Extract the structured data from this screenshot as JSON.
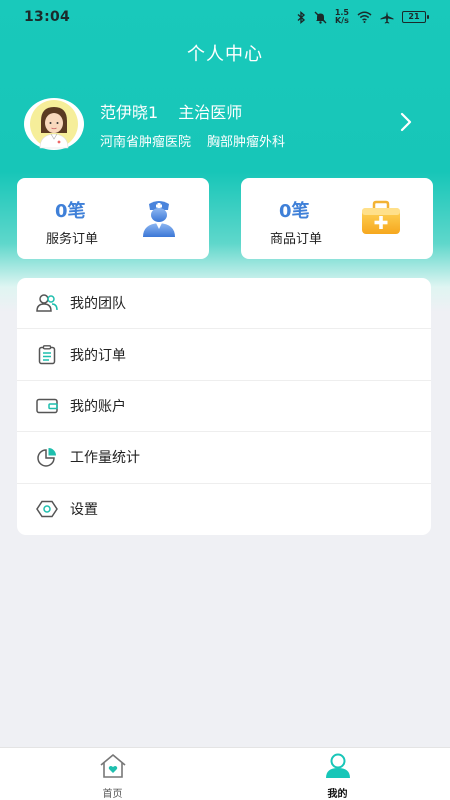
{
  "status_bar": {
    "time": "13:04",
    "net_speed_value": "1.5",
    "net_speed_unit": "K/s",
    "battery": "21",
    "icons": [
      "bluetooth-icon",
      "mute-icon",
      "wifi-icon",
      "airplane-icon",
      "battery-icon"
    ]
  },
  "header": {
    "title": "个人中心"
  },
  "profile": {
    "name": "范伊晓1",
    "job_title": "主治医师",
    "hospital": "河南省肿瘤医院",
    "department": "胸部肿瘤外科"
  },
  "stats": {
    "service_orders": {
      "count": "0笔",
      "label": "服务订单"
    },
    "product_orders": {
      "count": "0笔",
      "label": "商品订单"
    }
  },
  "menu": {
    "items": [
      {
        "label": "我的团队",
        "icon": "team-icon"
      },
      {
        "label": "我的订单",
        "icon": "order-list-icon"
      },
      {
        "label": "我的账户",
        "icon": "wallet-icon"
      },
      {
        "label": "工作量统计",
        "icon": "pie-chart-icon"
      },
      {
        "label": "设置",
        "icon": "settings-icon"
      }
    ]
  },
  "tab_bar": {
    "tabs": [
      {
        "label": "首页",
        "icon": "home-icon",
        "active": false
      },
      {
        "label": "我的",
        "icon": "profile-icon",
        "active": true
      }
    ]
  },
  "colors": {
    "brand": "#19c9bb",
    "count_blue": "#3f80d8",
    "background": "#eff0f4"
  }
}
